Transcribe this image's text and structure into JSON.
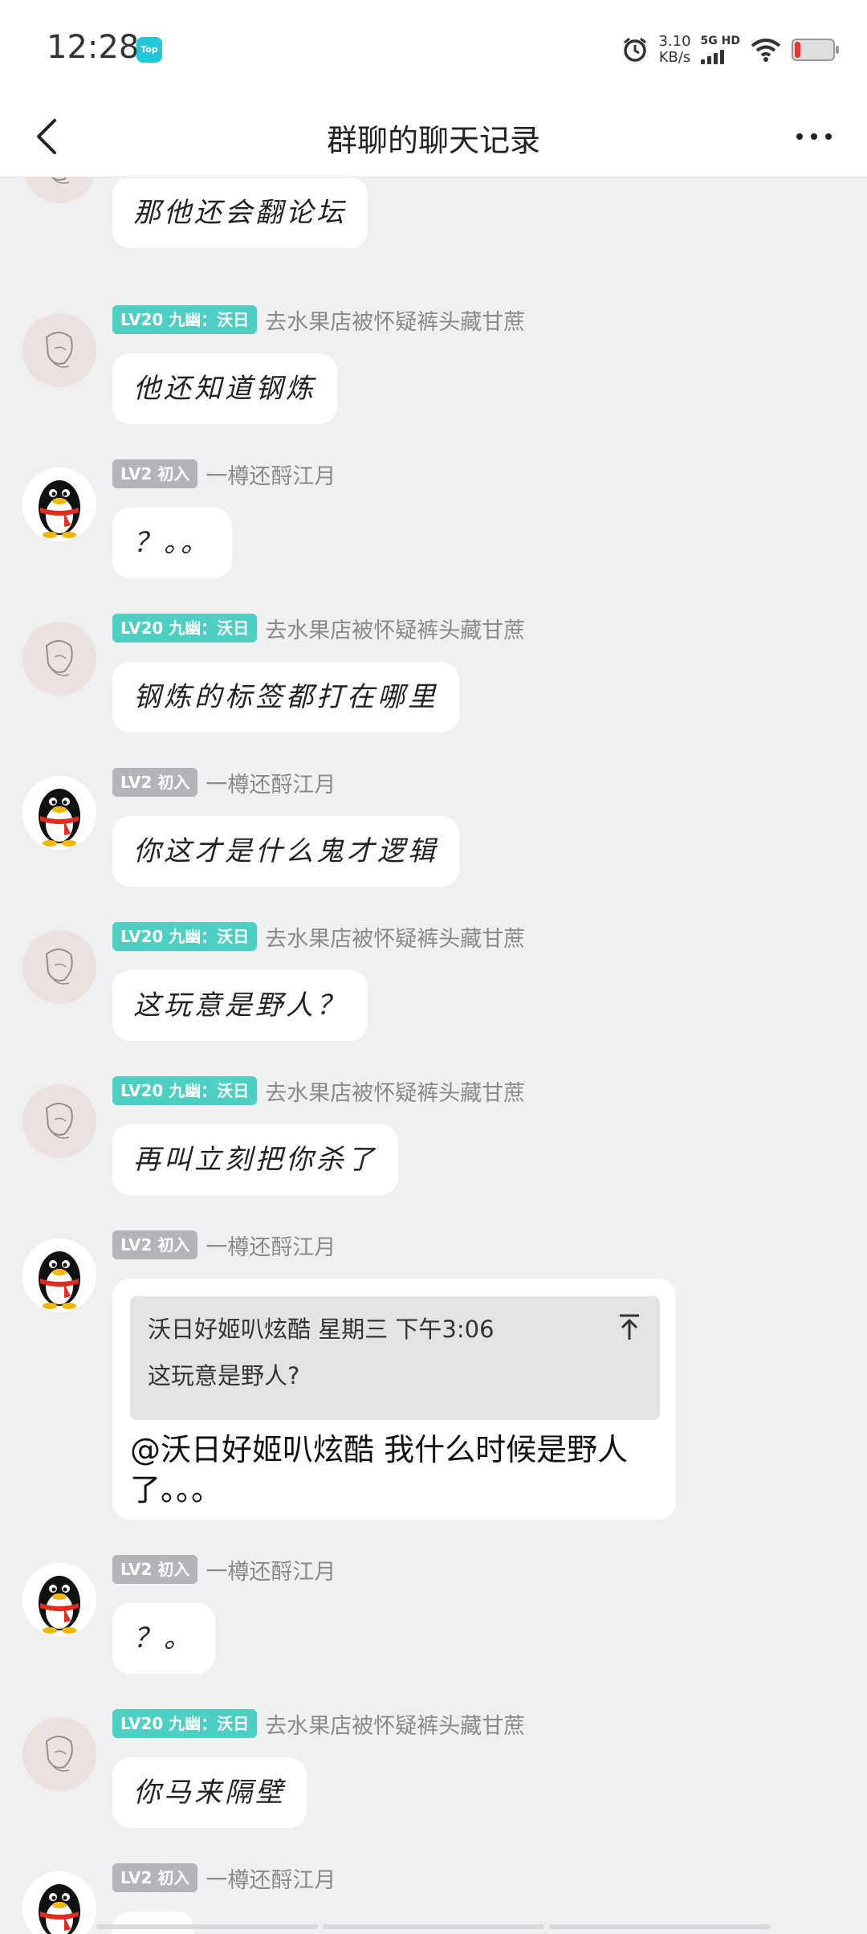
{
  "status_bar": {
    "time": "12:28",
    "app_icon_label": "Top",
    "net_speed_value": "3.10",
    "net_speed_unit": "KB/s",
    "network": "5G HD",
    "battery_percent": 15,
    "battery_color": "#e53935"
  },
  "header": {
    "title": "群聊的聊天记录",
    "back_icon": "chevron-left-icon",
    "more_icon": "more-horizontal-icon"
  },
  "colors": {
    "teal_badge": "#4ecfc3",
    "gray_badge": "#b4b4b8",
    "background": "#f0f0f2"
  },
  "messages": [
    {
      "text": "那他还会翻论坛"
    },
    {
      "badge": "LV20 九幽：沃日",
      "sender": "去水果店被怀疑裤头藏甘蔗",
      "text": "他还知道钢炼"
    },
    {
      "badge": "LV2 初入",
      "sender": "一樽还酹江月",
      "text": "？。。"
    },
    {
      "badge": "LV20 九幽：沃日",
      "sender": "去水果店被怀疑裤头藏甘蔗",
      "text": "钢炼的标签都打在哪里"
    },
    {
      "badge": "LV2 初入",
      "sender": "一樽还酹江月",
      "text": "你这才是什么鬼才逻辑"
    },
    {
      "badge": "LV20 九幽：沃日",
      "sender": "去水果店被怀疑裤头藏甘蔗",
      "text": "这玩意是野人？"
    },
    {
      "badge": "LV20 九幽：沃日",
      "sender": "去水果店被怀疑裤头藏甘蔗",
      "text": "再叫立刻把你杀了"
    },
    {
      "badge": "LV2 初入",
      "sender": "一樽还酹江月",
      "quote_header": "沃日好姬叭炫酷 星期三 下午3:06",
      "quote_text": "这玩意是野人?",
      "text": "@沃日好姬叭炫酷 我什么时候是野人了。。。"
    },
    {
      "badge": "LV2 初入",
      "sender": "一樽还酹江月",
      "text": "？。"
    },
    {
      "badge": "LV20 九幽：沃日",
      "sender": "去水果店被怀疑裤头藏甘蔗",
      "text": "你马来隔壁"
    },
    {
      "badge": "LV2 初入",
      "sender": "一樽还酹江月"
    }
  ]
}
